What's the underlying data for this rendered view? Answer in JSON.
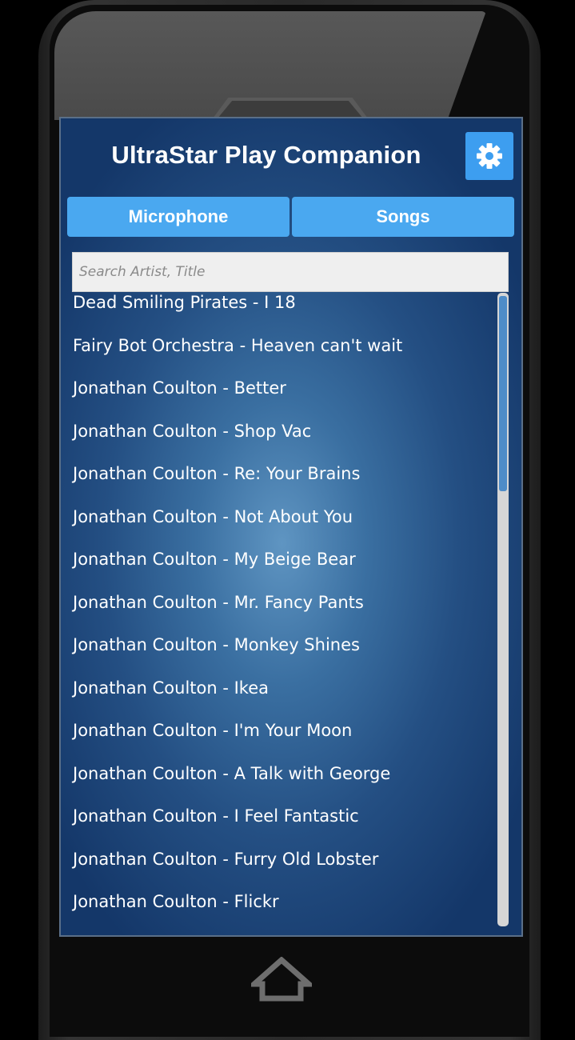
{
  "app": {
    "title": "UltraStar Play Companion",
    "settings_icon": "gear-icon"
  },
  "tabs": [
    {
      "label": "Microphone"
    },
    {
      "label": "Songs"
    }
  ],
  "search": {
    "placeholder": "Search Artist, Title",
    "value": ""
  },
  "songs": [
    "Dead Smiling Pirates - I 18",
    "Fairy Bot Orchestra - Heaven can't wait",
    "Jonathan Coulton - Better",
    "Jonathan Coulton - Shop Vac",
    "Jonathan Coulton - Re: Your Brains",
    "Jonathan Coulton - Not About You",
    "Jonathan Coulton - My Beige Bear",
    "Jonathan Coulton - Mr. Fancy Pants",
    "Jonathan Coulton - Monkey Shines",
    "Jonathan Coulton - Ikea",
    "Jonathan Coulton - I'm Your Moon",
    "Jonathan Coulton - A Talk with George",
    "Jonathan Coulton - I Feel Fantastic",
    "Jonathan Coulton - Furry Old Lobster",
    "Jonathan Coulton - Flickr"
  ],
  "colors": {
    "accent": "#4aa8f0",
    "settings_button": "#3d9ef0",
    "background_center": "#5f95c2",
    "background_edge": "#143769"
  },
  "device": {
    "home_icon": "home-icon"
  }
}
